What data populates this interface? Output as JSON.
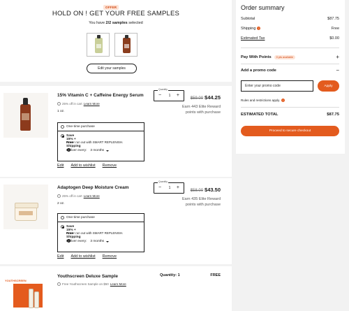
{
  "samples": {
    "badge": "OFFER",
    "heading": "HOLD ON ! GET YOUR FREE SAMPLES",
    "count_prefix": "You have ",
    "count_value": "2/2 samples",
    "count_suffix": " selected",
    "edit_button": "Edit your samples"
  },
  "items": [
    {
      "name": "15% Vitamin C + Caffeine Energy Serum",
      "promo": "25% off in cart",
      "promo_link": "Learn More",
      "size": "1 oz.",
      "quantity_label": "Quantity",
      "quantity": "1",
      "old_price": "$59.00",
      "new_price": "$44.25",
      "reward": "Earn 443 Elite Reward points with purchase",
      "option_one_time": "One-time purchase",
      "option_subscribe": "Save 15% + Free Shipping",
      "subscribe_note": "Never run out with SMART REPLENISH.",
      "deliver_label": "Deliver every:",
      "deliver_value": "3 months",
      "edit": "Edit",
      "wishlist": "Add to wishlist",
      "remove": "Remove"
    },
    {
      "name": "Adaptogen Deep Moisture Cream",
      "promo": "25% off in cart",
      "promo_link": "Learn More",
      "size": "2 oz.",
      "quantity_label": "Quantity",
      "quantity": "1",
      "old_price": "$58.00",
      "new_price": "$43.50",
      "reward": "Earn 435 Elite Reward points with purchase",
      "option_one_time": "One-time purchase",
      "option_subscribe": "Save 15% + Free Shipping",
      "subscribe_note": "Never run out with SMART REPLENISH.",
      "deliver_label": "Deliver every:",
      "deliver_value": "3 months",
      "edit": "Edit",
      "wishlist": "Add to wishlist",
      "remove": "Remove"
    },
    {
      "name": "Youthscreen Deluxe Sample",
      "promo": "Free Youthscreen Sample on $50",
      "promo_link": "Learn More",
      "quantity_text": "Quantity: 1",
      "price": "FREE",
      "image_text": "YOUTHSCREEN"
    }
  ],
  "summary": {
    "title": "Order summary",
    "subtotal_label": "Subtotal",
    "subtotal_value": "$87.75",
    "shipping_label": "Shipping",
    "shipping_value": "Free",
    "tax_label": "Estimated Tax",
    "tax_value": "$0.00",
    "pay_points_label": "Pay With Points",
    "points_badge": "0 pts available",
    "promo_label": "Add a promo code",
    "promo_placeholder": "Enter your promo code",
    "apply": "Apply",
    "rules": "Rules and restrictions apply.",
    "total_label": "ESTIMATED TOTAL",
    "total_value": "$87.75",
    "checkout": "Proceed to secure checkout"
  },
  "colors": {
    "accent": "#e35b1e",
    "badge_bg": "#fde3d6"
  },
  "icons": [
    "info-icon",
    "question-icon",
    "tag-icon",
    "plus-icon",
    "minus-icon",
    "caret-down-icon"
  ]
}
